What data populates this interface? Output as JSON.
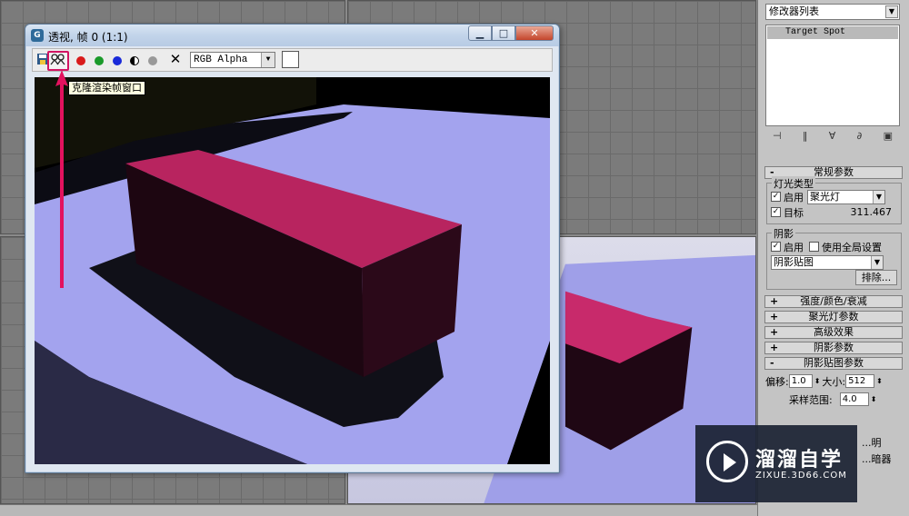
{
  "render_window": {
    "title": "透视, 帧 0 (1:1)",
    "min_label": "▁",
    "max_label": "□",
    "close_label": "✕",
    "toolbar": {
      "save_icon": "save-icon",
      "clone_icon": "clone-render-frame-icon",
      "channel_select_value": "RGB Alpha",
      "clear_icon": "✕"
    },
    "tooltip": "克隆渲染帧窗口"
  },
  "command_panel": {
    "modifier_list": "修改器列表",
    "stack_item": "Target Spot",
    "rollups": {
      "general": "常规参数",
      "light_type_group": "灯光类型",
      "enable_label": "启用",
      "light_type_value": "聚光灯",
      "target_label": "目标",
      "target_distance": "311.467",
      "shadows_group": "阴影",
      "shadows_enable": "启用",
      "use_global": "使用全局设置",
      "shadow_type_value": "阴影贴图",
      "exclude_button": "排除...",
      "intensity": "强度/颜色/衰减",
      "spotlight": "聚光灯参数",
      "advanced": "高级效果",
      "shadow_params": "阴影参数",
      "shadow_map_params": "阴影贴图参数",
      "bias_label": "偏移:",
      "bias_value": "1.0",
      "size_label": "大小:",
      "size_value": "512",
      "sample_range_label": "采样范围:",
      "sample_range_value": "4.0",
      "partial_1": "...明",
      "partial_2": "...暗器"
    }
  },
  "watermark": {
    "title": "溜溜自学",
    "subtitle": "ZIXUE.3D66.COM"
  },
  "colors": {
    "accent": "#d21563",
    "box_top": "#b8245f",
    "floor": "#a8a8f0"
  }
}
